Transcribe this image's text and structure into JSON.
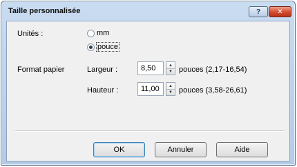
{
  "window": {
    "title": "Taille personnalisée"
  },
  "titlebar": {
    "help_glyph": "?",
    "close_glyph": "✕"
  },
  "units": {
    "label": "Unités :",
    "options": [
      {
        "label": "mm",
        "selected": false
      },
      {
        "label": "pouce",
        "selected": true
      }
    ]
  },
  "paper": {
    "label": "Format papier",
    "width": {
      "label": "Largeur :",
      "value": "8,50",
      "range": "pouces (2,17-16,54)"
    },
    "height": {
      "label": "Hauteur :",
      "value": "11,00",
      "range": "pouces (3,58-26,61)"
    }
  },
  "buttons": {
    "ok": "OK",
    "cancel": "Annuler",
    "help": "Aide"
  }
}
